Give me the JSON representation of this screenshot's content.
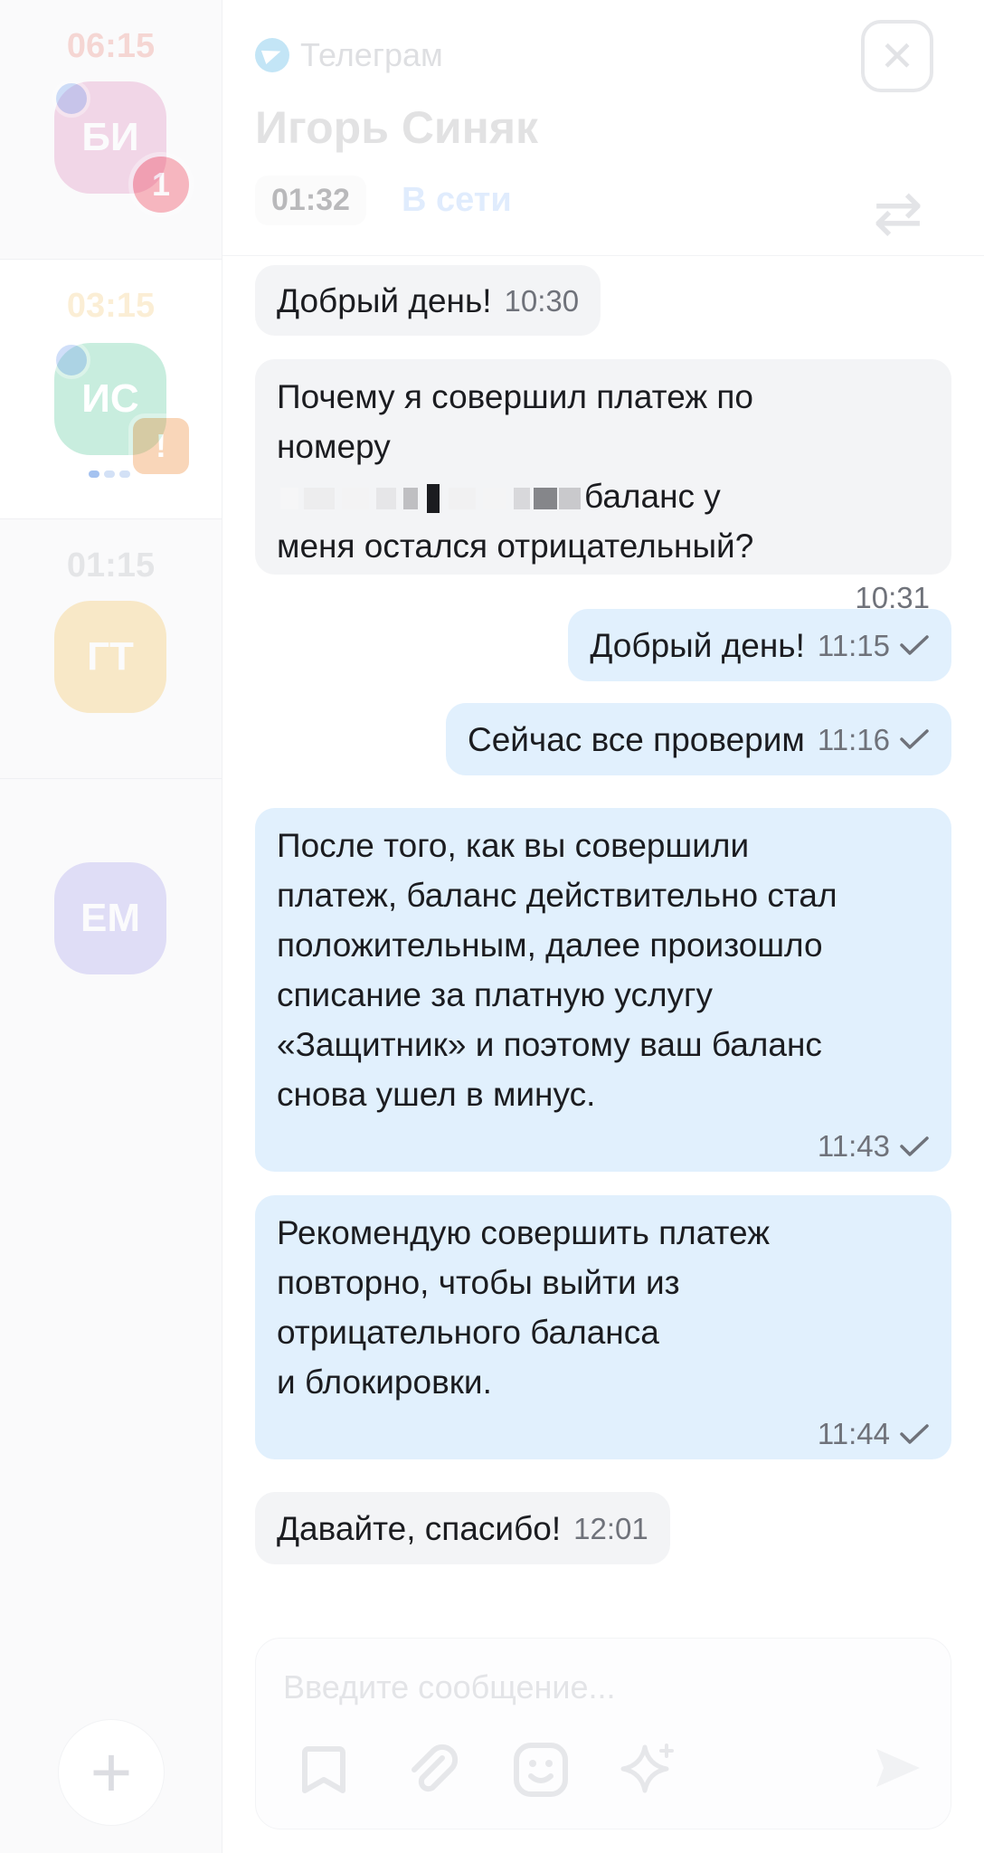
{
  "sidebar": {
    "chats": [
      {
        "time": "06:15",
        "initials": "БИ",
        "avatar_color": "#e08ec0",
        "time_color": "#e5594a",
        "badge": "1",
        "badge_color": "#ef3b53"
      },
      {
        "time": "03:15",
        "initials": "ИС",
        "avatar_color": "#57c99c",
        "time_color": "#f1b443",
        "badge": "!",
        "badge_color": "#f08d3a"
      },
      {
        "time": "01:15",
        "initials": "ГТ",
        "avatar_color": "#f5c35b",
        "time_color": "#9a9ca3"
      },
      {
        "time": "",
        "initials": "ЕМ",
        "avatar_color": "#a9a2ee"
      }
    ],
    "add_icon": "plus-icon"
  },
  "header": {
    "channel": "Телеграм",
    "channel_icon": "telegram-icon",
    "contact_name": "Игорь Синяк",
    "session_timer": "01:32",
    "status": "В сети",
    "close_icon": "close-icon",
    "transfer_icon": "transfer-arrows-icon"
  },
  "messages": [
    {
      "dir": "in",
      "text": "Добрый день!",
      "time": "10:30"
    },
    {
      "dir": "in",
      "text_before": "Почему я совершил платеж по\nномеру",
      "text_after": "баланс у\nменя остался отрицательный?",
      "time": "10:31"
    },
    {
      "dir": "out",
      "text": "Добрый день!",
      "time": "11:15"
    },
    {
      "dir": "out",
      "text": "Сейчас все проверим",
      "time": "11:16"
    },
    {
      "dir": "out",
      "text": "После того, как вы совершили\nплатеж, баланс действительно стал\nположительным, далее произошло\nсписание за платную услугу\n«Защитник» и поэтому ваш баланс\nснова ушел в минус.",
      "time": "11:43"
    },
    {
      "dir": "out",
      "text": "Рекомендую совершить платеж\nповторно, чтобы выйти из\nотрицательного баланса\nи блокировки.",
      "time": "11:44"
    },
    {
      "dir": "in",
      "text": "Давайте, спасибо!",
      "time": "12:01"
    }
  ],
  "composer": {
    "placeholder": "Введите сообщение...",
    "tools": [
      "bookmark-icon",
      "paperclip-icon",
      "emoji-icon",
      "sparkle-icon"
    ],
    "send_icon": "send-icon"
  },
  "colors": {
    "incoming_bubble": "#f3f4f6",
    "outgoing_bubble": "#e1f0fd",
    "read_check": "#6f727a"
  }
}
